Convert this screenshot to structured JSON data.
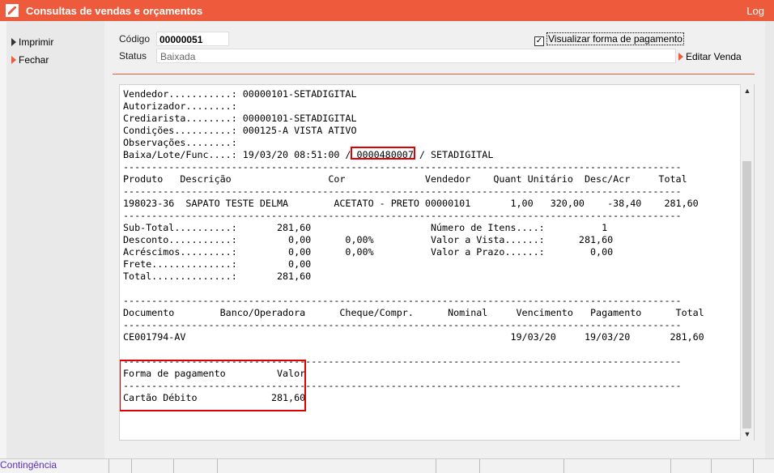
{
  "window": {
    "title": "Consultas de vendas e orçamentos",
    "log_label": "Log"
  },
  "left_menu": {
    "imprimir": "Imprimir",
    "fechar": "Fechar"
  },
  "form": {
    "codigo_label": "Código",
    "codigo_value": "00000051",
    "status_label": "Status",
    "status_value": "Baixada",
    "visualizar_label": "Visualizar forma de pagamento",
    "editar_label": "Editar Venda"
  },
  "report": {
    "header": {
      "vendedor": "Vendedor...........: 00000101-SETADIGITAL",
      "autorizador": "Autorizador........:",
      "crediarista": "Crediarista........: 00000101-SETADIGITAL",
      "condicoes": "Condições..........: 000125-A VISTA ATIVO",
      "observacoes": "Observações........:",
      "baixa": "Baixa/Lote/Func....: 19/03/20 08:51:00 / 0000480007 / SETADIGITAL"
    },
    "rule": "--------------------------------------------------------------------------------------------------",
    "product_header": "Produto   Descrição                 Cor              Vendedor    Quant Unitário  Desc/Acr     Total",
    "product_row": "198023-36  SAPATO TESTE DELMA        ACETATO - PRETO 00000101       1,00   320,00    -38,40    281,60",
    "totals": [
      "Sub-Total..........:       281,60                     Número de Itens....:          1",
      "Desconto...........:         0,00      0,00%          Valor a Vista......:      281,60",
      "Acréscimos.........:         0,00      0,00%          Valor a Prazo......:        0,00",
      "Frete..............:         0,00",
      "Total..............:       281,60"
    ],
    "doc_header": "Documento        Banco/Operadora      Cheque/Compr.      Nominal     Vencimento   Pagamento      Total",
    "doc_row": "CE001794-AV                                                         19/03/20     19/03/20       281,60",
    "pay_header": "Forma de pagamento         Valor",
    "pay_row": "Cartão Débito             281,60"
  },
  "footer": {
    "contingencia": "Contingência"
  }
}
